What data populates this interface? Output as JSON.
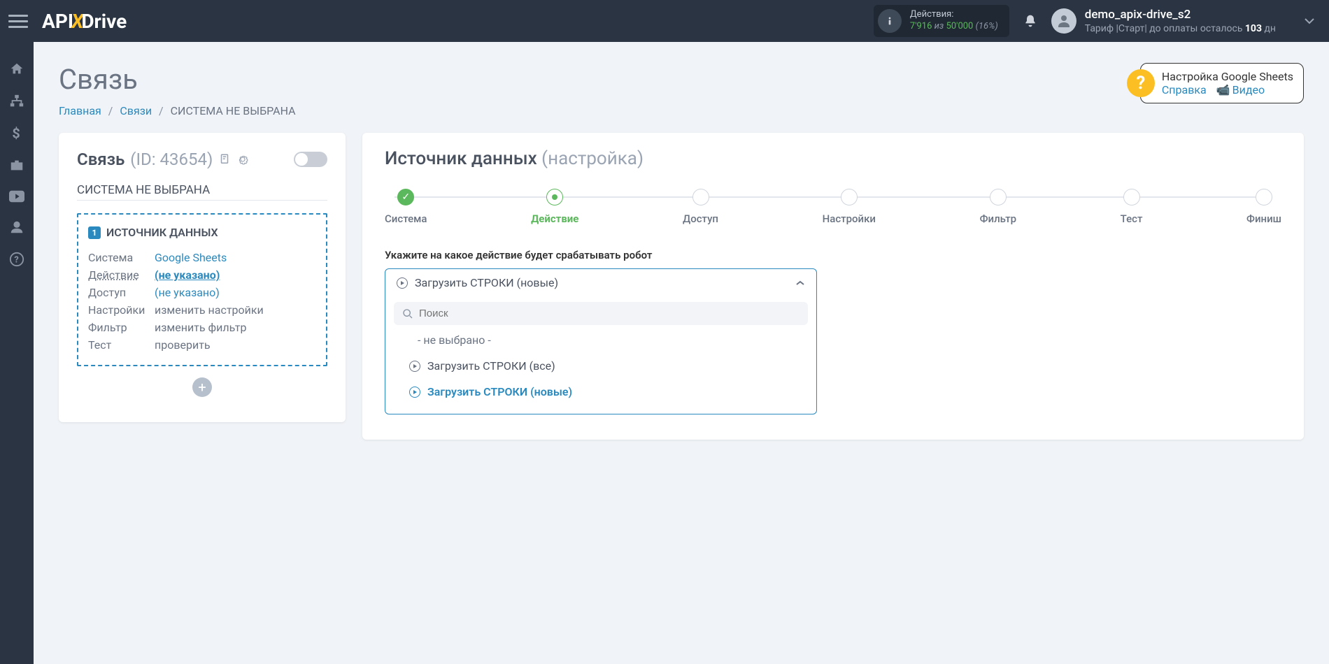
{
  "topnav": {
    "logo": {
      "p1": "API",
      "p2": "X",
      "p3": "Drive"
    },
    "actions": {
      "label": "Действия:",
      "used": "7'916",
      "of": "из",
      "total": "50'000",
      "pct": "(16%)"
    },
    "user": {
      "name": "demo_apix-drive_s2",
      "plan_prefix": "Тариф |Старт|  до оплаты осталось ",
      "plan_days": "103",
      "plan_suffix": " дн"
    }
  },
  "sidenav": {
    "items": [
      "home",
      "sitemap",
      "dollar",
      "briefcase",
      "youtube",
      "user",
      "help"
    ]
  },
  "header": {
    "title": "Связь",
    "breadcrumb": {
      "home": "Главная",
      "links": "Связи",
      "current": "СИСТЕМА НЕ ВЫБРАНА"
    },
    "help": {
      "title": "Настройка Google Sheets",
      "link1": "Справка",
      "link2": "Видео"
    }
  },
  "left": {
    "title": "Связь",
    "id_label": "(ID: 43654)",
    "subtitle": "СИСТЕМА НЕ ВЫБРАНА",
    "source_header": "ИСТОЧНИК ДАННЫХ",
    "rows": [
      {
        "label": "Система",
        "value": "Google Sheets",
        "link": true,
        "u": false,
        "bold": false
      },
      {
        "label": "Действие",
        "value": "(не указано)",
        "link": true,
        "u": true,
        "bold": true,
        "label_u": true
      },
      {
        "label": "Доступ",
        "value": "(не указано)",
        "link": true,
        "u": false,
        "bold": false
      },
      {
        "label": "Настройки",
        "value": "изменить настройки",
        "link": false,
        "u": false,
        "bold": false
      },
      {
        "label": "Фильтр",
        "value": "изменить фильтр",
        "link": false,
        "u": false,
        "bold": false
      },
      {
        "label": "Тест",
        "value": "проверить",
        "link": false,
        "u": false,
        "bold": false
      }
    ]
  },
  "right": {
    "title": "Источник данных",
    "title_suffix": "(настройка)",
    "steps": [
      "Система",
      "Действие",
      "Доступ",
      "Настройки",
      "Фильтр",
      "Тест",
      "Финиш"
    ],
    "step_active_index": 1,
    "action_label": "Укажите на какое действие будет срабатывать робот",
    "dropdown": {
      "selected": "Загрузить СТРОКИ (новые)",
      "search_placeholder": "Поиск",
      "none_label": "- не выбрано -",
      "options": [
        "Загрузить СТРОКИ (все)",
        "Загрузить СТРОКИ (новые)"
      ],
      "selected_index": 1
    }
  }
}
